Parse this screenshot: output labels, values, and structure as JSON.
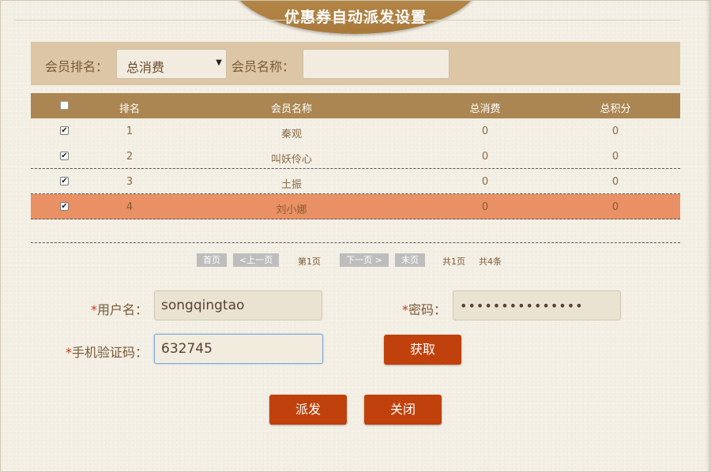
{
  "dialog": {
    "title": "优惠券自动派发设置"
  },
  "filter": {
    "rank_label": "会员排名：",
    "rank_selected": "总消费",
    "name_label": "会员名称：",
    "name_value": ""
  },
  "table": {
    "columns": [
      "排名",
      "会员名称",
      "总消费",
      "总积分"
    ],
    "rows": [
      {
        "checked": true,
        "rank": "1",
        "name": "秦观",
        "spend": "0",
        "points": "0"
      },
      {
        "checked": true,
        "rank": "2",
        "name": "叫妖伶心",
        "spend": "0",
        "points": "0"
      },
      {
        "checked": true,
        "rank": "3",
        "name": "土振",
        "spend": "0",
        "points": "0"
      },
      {
        "checked": true,
        "rank": "4",
        "name": "刘小娜",
        "spend": "0",
        "points": "0"
      }
    ]
  },
  "pager": {
    "first": "首页",
    "prev": "<上一页",
    "current": "第1页",
    "next": "下一页 >",
    "last": "末页",
    "total_pages": "共1页",
    "total_items": "共4条"
  },
  "form": {
    "required_mark": "*",
    "username_label": "用户名：",
    "username_value": "songqingtao",
    "password_label": "密码：",
    "password_value": "•••••••••••••••",
    "code_label": "手机验证码：",
    "code_value": "632745",
    "get_code_label": "获取"
  },
  "actions": {
    "dispatch_label": "派发",
    "close_label": "关闭"
  },
  "colors": {
    "accent": "#c0410b",
    "header": "#ab8652",
    "highlight_row": "#e99064"
  }
}
